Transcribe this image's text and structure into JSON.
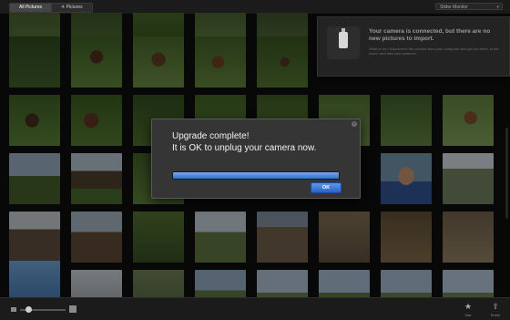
{
  "toolbar": {
    "tabs": [
      {
        "label": "All Pictures",
        "active": true
      },
      {
        "label": "✳ Pictures",
        "active": false
      }
    ],
    "device_dropdown": {
      "label": "Slider Monitor"
    }
  },
  "notification": {
    "title": "Your camera is connected, but there are no new pictures to import.",
    "detail": "What to do? Disconnect the camera from your computer and get out there, in the world, and take new pictures!"
  },
  "dialog": {
    "line1": "Upgrade complete!",
    "line2": "It is OK to unplug your camera now.",
    "ok_label": "OK",
    "progress": 1.0
  },
  "bottom": {
    "star_label": "Star",
    "share_label": "Share"
  },
  "colors": {
    "accent": "#2f6fc8",
    "background": "#0d0d0d"
  }
}
